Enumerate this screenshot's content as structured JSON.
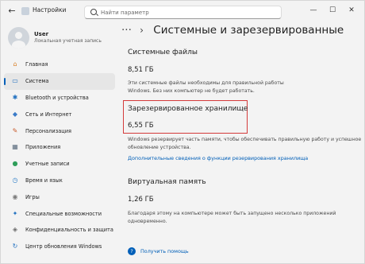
{
  "titlebar": {
    "app_title": "Настройки",
    "back_icon": "back-arrow-icon",
    "minimize": "—",
    "maximize": "☐",
    "close": "✕"
  },
  "search": {
    "placeholder": "Найти параметр",
    "value": ""
  },
  "profile": {
    "name": "User",
    "account_type": "Локальная учетная запись"
  },
  "sidebar": {
    "items": [
      {
        "label": "Главная",
        "icon": "home-icon",
        "glyph": "⌂",
        "color": "#d9822b",
        "active": false
      },
      {
        "label": "Система",
        "icon": "monitor-icon",
        "glyph": "▭",
        "color": "#1f6fbf",
        "active": true
      },
      {
        "label": "Bluetooth и устройства",
        "icon": "bluetooth-icon",
        "glyph": "✱",
        "color": "#1f6fbf",
        "active": false
      },
      {
        "label": "Сеть и Интернет",
        "icon": "network-icon",
        "glyph": "◆",
        "color": "#3a7bc8",
        "active": false
      },
      {
        "label": "Персонализация",
        "icon": "brush-icon",
        "glyph": "✎",
        "color": "#c95a2a",
        "active": false
      },
      {
        "label": "Приложения",
        "icon": "apps-icon",
        "glyph": "▦",
        "color": "#5a6b7c",
        "active": false
      },
      {
        "label": "Учетные записи",
        "icon": "account-icon",
        "glyph": "●",
        "color": "#2f9e5a",
        "active": false
      },
      {
        "label": "Время и язык",
        "icon": "globe-clock-icon",
        "glyph": "◷",
        "color": "#2f7fc8",
        "active": false
      },
      {
        "label": "Игры",
        "icon": "gamepad-icon",
        "glyph": "◉",
        "color": "#7a7a7a",
        "active": false
      },
      {
        "label": "Специальные возможности",
        "icon": "accessibility-icon",
        "glyph": "✦",
        "color": "#1f6fbf",
        "active": false
      },
      {
        "label": "Конфиденциальность и защита",
        "icon": "shield-icon",
        "glyph": "◈",
        "color": "#6a6a6a",
        "active": false
      },
      {
        "label": "Центр обновления Windows",
        "icon": "update-icon",
        "glyph": "↻",
        "color": "#1f6fbf",
        "active": false
      }
    ]
  },
  "breadcrumb": {
    "ellipsis": "···",
    "separator": "›",
    "title": "Системные и зарезервированные"
  },
  "sections": {
    "system_files": {
      "title": "Системные файлы",
      "value": "8,51 ГБ",
      "description_line1": "Эти системные файлы необходимы для правильной работы",
      "description_line2": "Windows. Без них компьютер не будет работать."
    },
    "reserved_storage": {
      "title": "Зарезервированное хранилище",
      "value": "6,55 ГБ",
      "description_line1": "Windows резервирует часть памяти, чтобы обеспечивать правильную работу и успешное",
      "description_line2": "обновление устройства.",
      "link": "Дополнительные сведения о функции резервирования хранилища"
    },
    "virtual_memory": {
      "title": "Виртуальная память",
      "value": "1,26 ГБ",
      "description_line1": "Благодаря этому на компьютере может быть запущено несколько приложений",
      "description_line2": "одновременно."
    }
  },
  "help": {
    "label": "Получить помощь",
    "icon": "help-icon"
  },
  "colors": {
    "accent": "#005fb8",
    "highlight_border": "#d43a3a",
    "window_bg": "#f3f3f3"
  }
}
